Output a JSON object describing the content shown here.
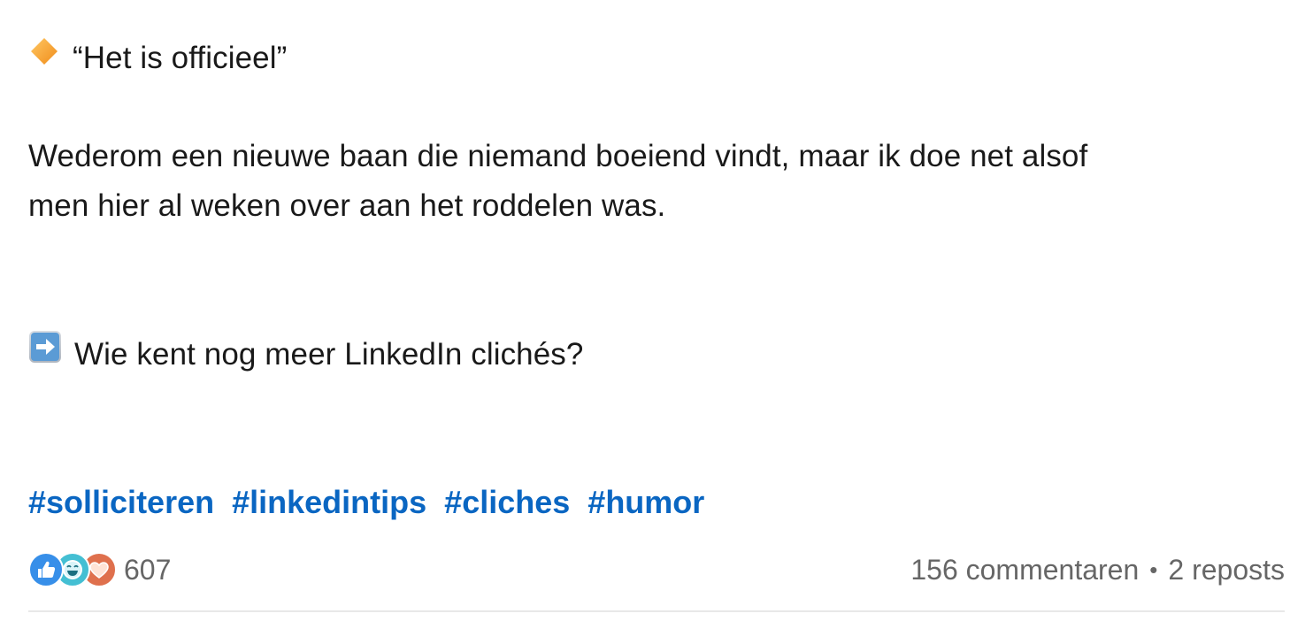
{
  "post": {
    "line1": "“Het is officieel”",
    "line2": "Wederom een nieuwe baan die niemand boeiend vindt, maar ik doe net alsof",
    "line3": "men hier al weken over aan het roddelen was.",
    "line4": "Wie kent nog meer LinkedIn clichés?",
    "icons": {
      "line1": "orange-diamond-icon",
      "line4": "right-arrow-icon"
    },
    "hashtags": [
      "#solliciteren",
      "#linkedintips",
      "#cliches",
      "#humor"
    ]
  },
  "social": {
    "reaction_icons": [
      "like-icon",
      "funny-icon",
      "love-icon"
    ],
    "reaction_count": "607",
    "comments": "156 commentaren",
    "separator": "•",
    "reposts": "2 reposts"
  },
  "colors": {
    "text": "#191919",
    "hashtag": "#0a66c2",
    "meta": "#666666",
    "divider": "#e8e8e8",
    "diamond": "#f5a623",
    "arrow_bg": "#4a90e2",
    "like": "#378fe9",
    "funny": "#44bfd3",
    "love": "#df704d"
  }
}
